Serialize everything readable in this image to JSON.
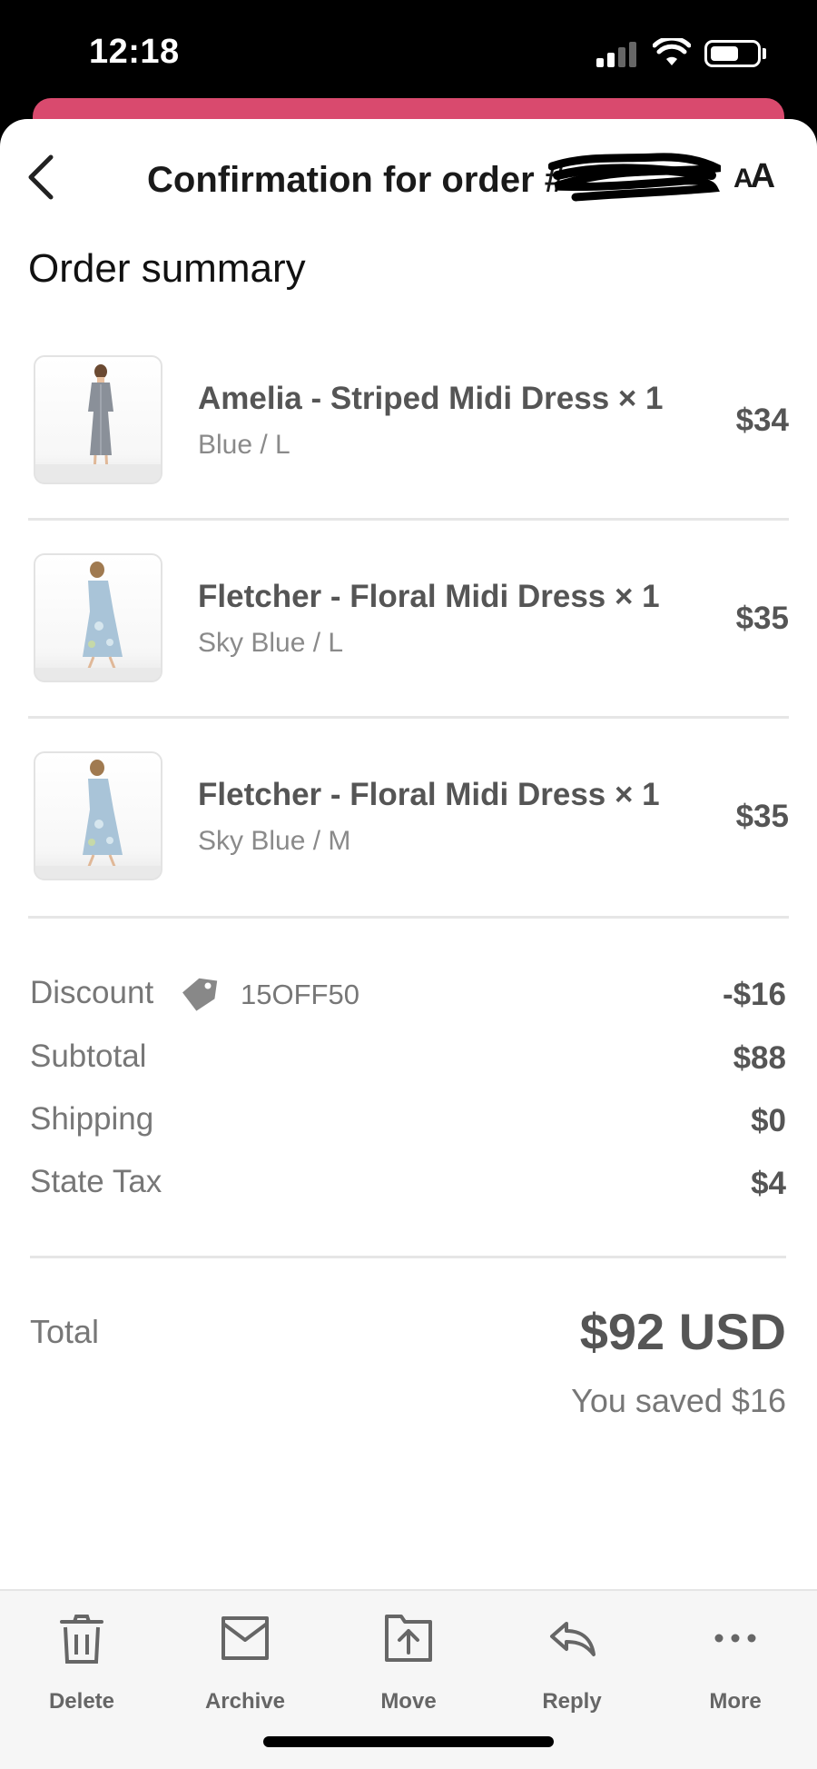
{
  "status_bar": {
    "time": "12:18"
  },
  "header": {
    "title": "Confirmation for order #",
    "text_size_button": {
      "big": "A",
      "small": "A"
    }
  },
  "summary": {
    "heading": "Order summary",
    "items": [
      {
        "name": "Amelia - Striped Midi Dress × 1",
        "variant": "Blue / L",
        "price": "$34"
      },
      {
        "name": "Fletcher - Floral Midi Dress × 1",
        "variant": "Sky Blue / L",
        "price": "$35"
      },
      {
        "name": "Fletcher - Floral Midi Dress × 1",
        "variant": "Sky Blue / M",
        "price": "$35"
      }
    ],
    "discount": {
      "label": "Discount",
      "code": "15OFF50",
      "value": "-$16",
      "icon": "tag-icon"
    },
    "subtotal": {
      "label": "Subtotal",
      "value": "$88"
    },
    "shipping": {
      "label": "Shipping",
      "value": "$0"
    },
    "tax": {
      "label": "State Tax",
      "value": "$4"
    },
    "total": {
      "label": "Total",
      "value": "$92 USD"
    },
    "saved": "You saved $16"
  },
  "toolbar": {
    "items": [
      {
        "label": "Delete",
        "icon": "trash-icon"
      },
      {
        "label": "Archive",
        "icon": "archive-icon"
      },
      {
        "label": "Move",
        "icon": "move-icon"
      },
      {
        "label": "Reply",
        "icon": "reply-icon"
      },
      {
        "label": "More",
        "icon": "more-icon"
      }
    ]
  },
  "colors": {
    "accent_strip": "#d94a6e",
    "text_primary": "#1a1a1a",
    "text_secondary": "#777777",
    "dress_striped": "#8a9099",
    "dress_floral": "#a9c4d8"
  }
}
